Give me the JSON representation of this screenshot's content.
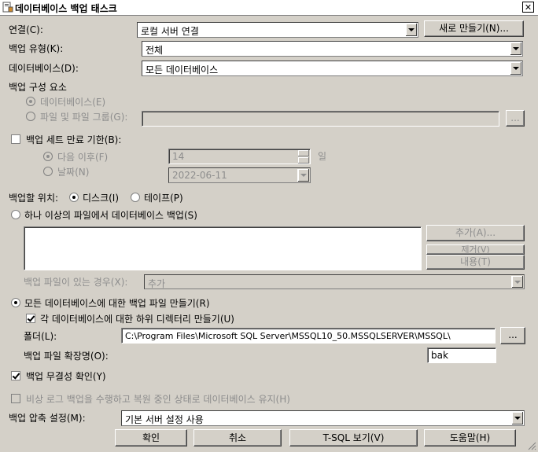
{
  "window": {
    "title": "데이터베이스 백업 태스크",
    "close_glyph": "✕"
  },
  "connection": {
    "label": "연결(C):",
    "value": "로컬 서버 연결",
    "new_button": "새로 만들기(N)..."
  },
  "backup_type": {
    "label": "백업 유형(K):",
    "value": "전체"
  },
  "databases": {
    "label": "데이터베이스(D):",
    "value": "모든 데이터베이스"
  },
  "components": {
    "label": "백업 구성 요소",
    "database_option": "데이터베이스(E)",
    "files_option": "파일 및 파일 그룹(G):",
    "files_value": "",
    "browse": "..."
  },
  "expire": {
    "label": "백업 세트 만료 기한(B):",
    "after_option": "다음 이후(F)",
    "after_value": "14",
    "after_unit": "일",
    "on_option": "날짜(N)",
    "on_value": "2022-06-11"
  },
  "destination": {
    "label": "백업할 위치:",
    "disk_option": "디스크(I)",
    "tape_option": "테이프(P)"
  },
  "across_files": {
    "label": "하나 이상의 파일에서 데이터베이스 백업(S)",
    "add_button": "추가(A)...",
    "remove_button": "제거(V)",
    "contents_button": "내용(T)",
    "if_exists_label": "백업 파일이 있는 경우(X):",
    "if_exists_value": "추가"
  },
  "per_db": {
    "label": "모든 데이터베이스에 대한 백업 파일 만들기(R)",
    "subdir_label": "각 데이터베이스에 대한 하위 디렉터리 만들기(U)",
    "folder_label": "폴더(L):",
    "folder_value": "C:\\Program Files\\Microsoft SQL Server\\MSSQL10_50.MSSQLSERVER\\MSSQL\\",
    "folder_browse": "...",
    "ext_label": "백업 파일 확장명(O):",
    "ext_value": "bak"
  },
  "verify": {
    "label": "백업 무결성 확인(Y)"
  },
  "tail_log": {
    "label": "비상 로그 백업을 수행하고 복원 중인 상태로 데이터베이스 유지(H)"
  },
  "compression": {
    "label": "백업 압축 설정(M):",
    "value": "기본 서버 설정 사용"
  },
  "buttons": {
    "ok": "확인",
    "cancel": "취소",
    "tsql": "T-SQL 보기(V)",
    "help": "도움말(H)"
  }
}
